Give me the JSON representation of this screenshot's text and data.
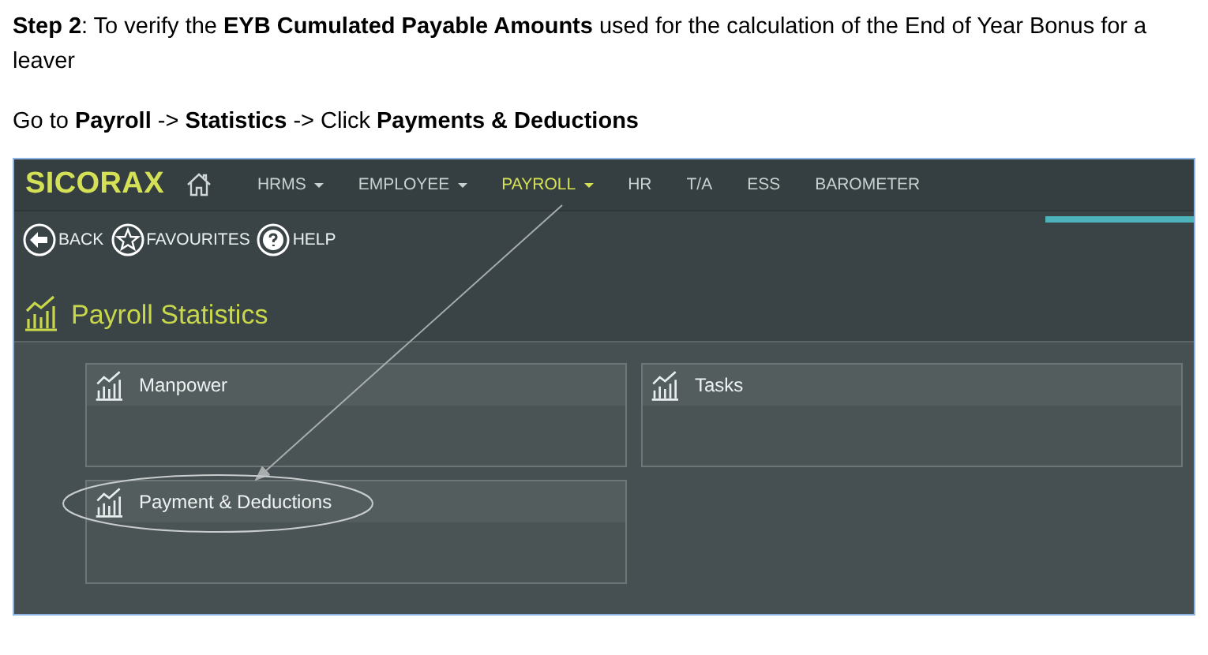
{
  "instruction": {
    "step": "**Step 2**: To verify the **EYB Cumulated Payable Amounts** used for the calculation of the End of Year Bonus for a leaver",
    "path": "Go to **Payroll** -> **Statistics** -> Click **Payments & Deductions**"
  },
  "app": {
    "logo": "SICORAX",
    "nav": [
      {
        "label": "HRMS",
        "has_menu": true,
        "selected": false
      },
      {
        "label": "EMPLOYEE",
        "has_menu": true,
        "selected": false
      },
      {
        "label": "PAYROLL",
        "has_menu": true,
        "selected": true
      },
      {
        "label": "HR",
        "has_menu": false,
        "selected": false
      },
      {
        "label": "T/A",
        "has_menu": false,
        "selected": false
      },
      {
        "label": "ESS",
        "has_menu": false,
        "selected": false
      },
      {
        "label": "BAROMETER",
        "has_menu": false,
        "selected": false
      }
    ],
    "toolbar": [
      {
        "kind": "back",
        "label": "BACK"
      },
      {
        "kind": "favourites",
        "label": "FAVOURITES"
      },
      {
        "kind": "help",
        "label": "HELP"
      }
    ],
    "page_title": "Payroll Statistics",
    "cards": [
      {
        "title": "Manpower"
      },
      {
        "title": "Tasks"
      },
      {
        "title": "Payment & Deductions"
      }
    ]
  }
}
